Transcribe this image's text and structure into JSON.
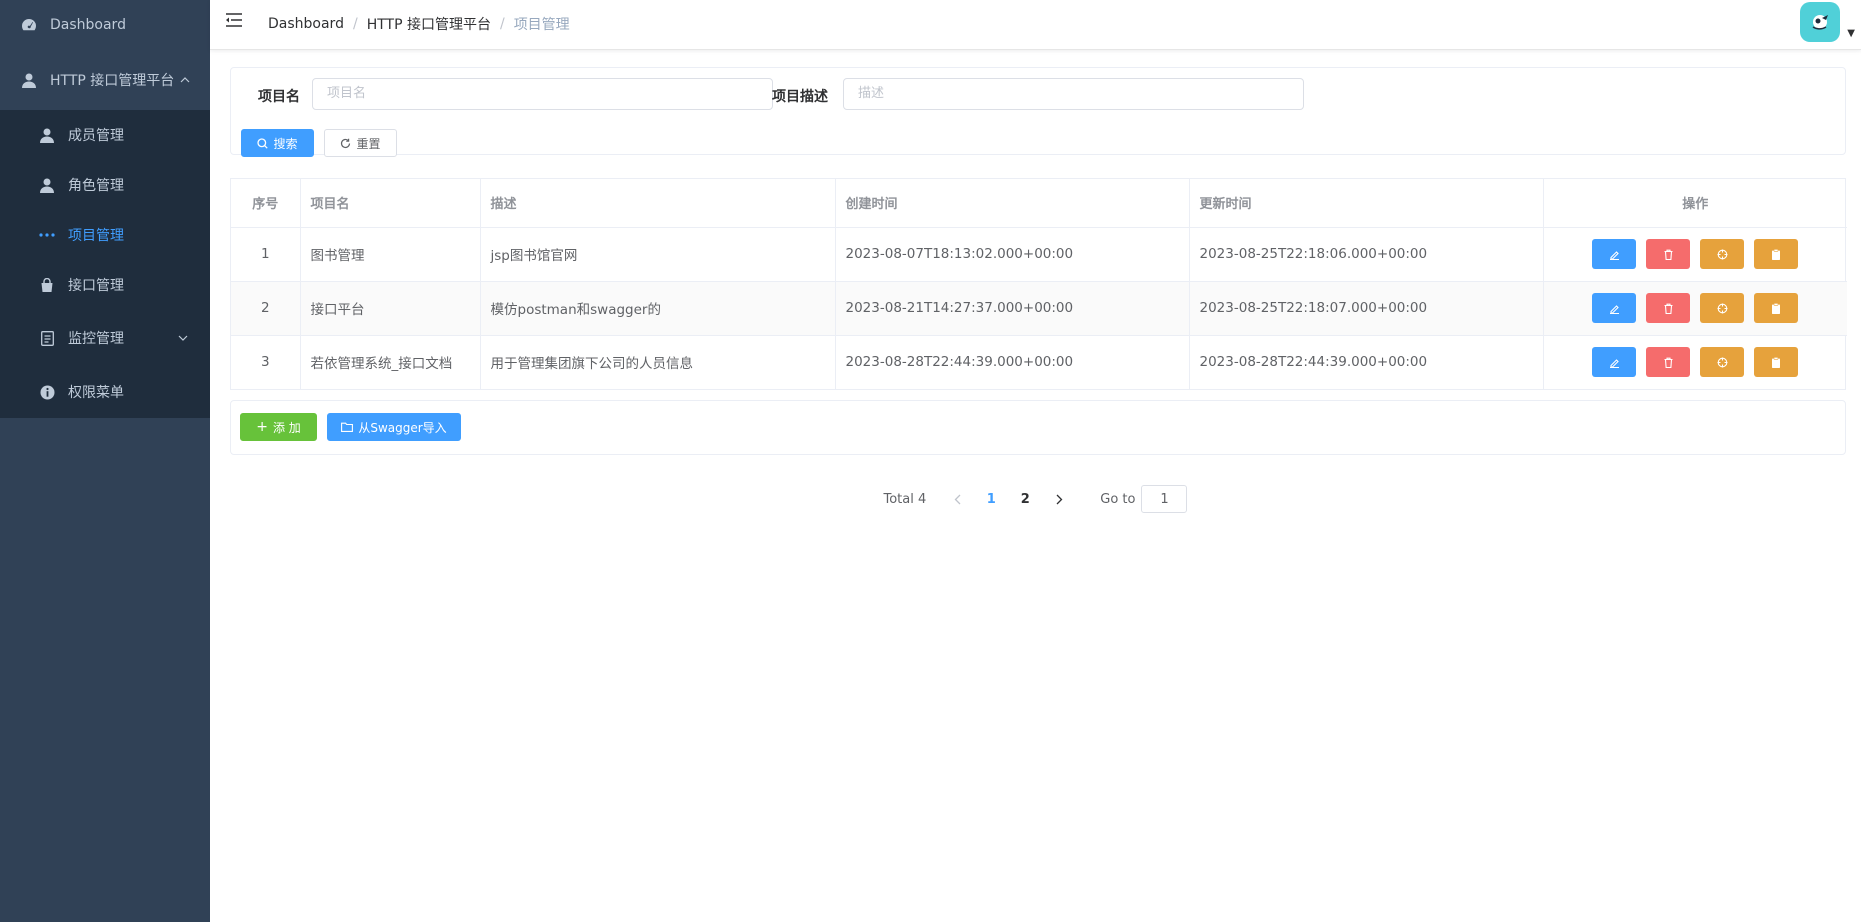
{
  "sidebar": {
    "dashboard": "Dashboard",
    "platform": "HTTP 接口管理平台",
    "items": [
      {
        "label": "成员管理",
        "icon": "user-icon"
      },
      {
        "label": "角色管理",
        "icon": "user-icon"
      },
      {
        "label": "项目管理",
        "icon": "more-dots-icon",
        "active": true
      },
      {
        "label": "接口管理",
        "icon": "bag-icon"
      }
    ],
    "monitor": "监控管理",
    "permission": "权限菜单"
  },
  "breadcrumb": [
    "Dashboard",
    "HTTP 接口管理平台",
    "项目管理"
  ],
  "search": {
    "name_label": "项目名",
    "name_placeholder": "项目名",
    "desc_label": "项目描述",
    "desc_placeholder": "描述",
    "search_button": "搜索",
    "reset_button": "重置"
  },
  "table": {
    "headers": [
      "序号",
      "项目名",
      "描述",
      "创建时间",
      "更新时间",
      "操作"
    ],
    "rows": [
      {
        "index": "1",
        "name": "图书管理",
        "desc": "jsp图书馆官网",
        "created": "2023-08-07T18:13:02.000+00:00",
        "updated": "2023-08-25T22:18:06.000+00:00"
      },
      {
        "index": "2",
        "name": "接口平台",
        "desc": "模仿postman和swagger的",
        "created": "2023-08-21T14:27:37.000+00:00",
        "updated": "2023-08-25T22:18:07.000+00:00"
      },
      {
        "index": "3",
        "name": "若依管理系统_接口文档",
        "desc": "用于管理集团旗下公司的人员信息",
        "created": "2023-08-28T22:44:39.000+00:00",
        "updated": "2023-08-28T22:44:39.000+00:00"
      }
    ]
  },
  "actions": {
    "add_button": "添 加",
    "import_button": "从Swagger导入"
  },
  "pagination": {
    "total": "Total 4",
    "pages": [
      "1",
      "2"
    ],
    "current": "1",
    "goto_label": "Go to",
    "goto_value": "1"
  },
  "colors": {
    "sidebar_bg": "#304156",
    "accent": "#409eff",
    "danger": "#f56c6c",
    "warning": "#e6a23c",
    "success": "#67c23a"
  }
}
